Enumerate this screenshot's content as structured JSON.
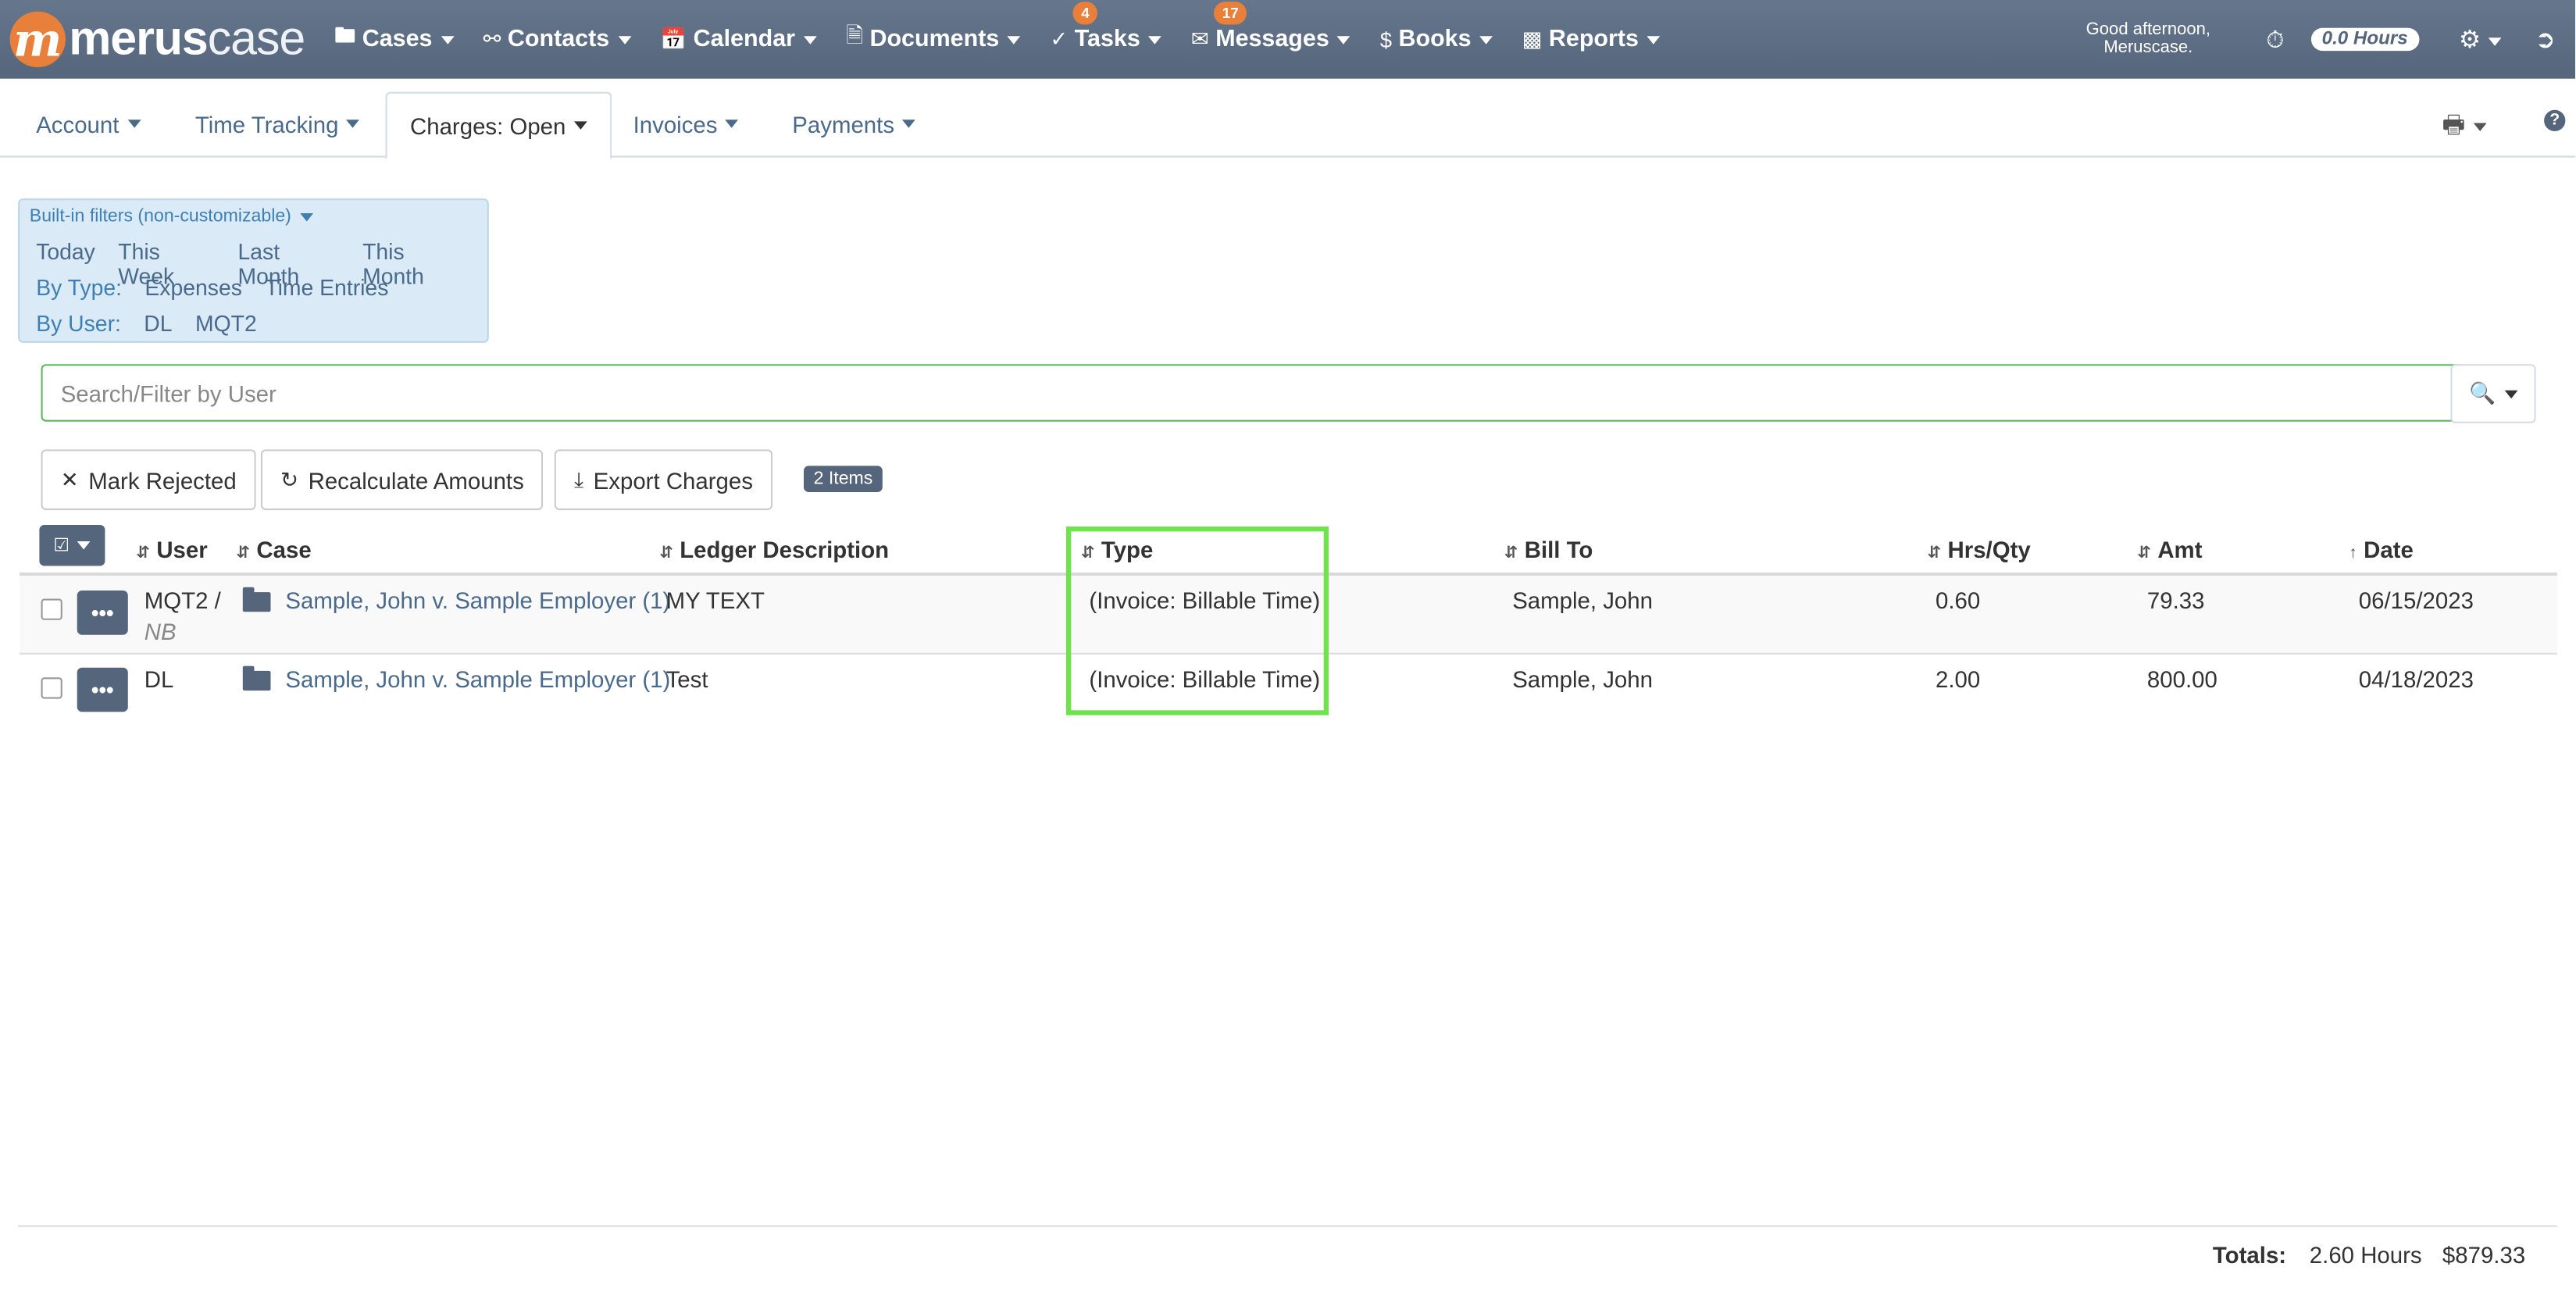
{
  "brand": {
    "logo_letter": "m",
    "name_bold": "merus",
    "name_light": "case"
  },
  "nav": {
    "items": [
      {
        "label": "Cases",
        "icon": "folder-icon"
      },
      {
        "label": "Contacts",
        "icon": "users-icon"
      },
      {
        "label": "Calendar",
        "icon": "calendar-icon"
      },
      {
        "label": "Documents",
        "icon": "document-icon"
      },
      {
        "label": "Tasks",
        "icon": "check-circle-icon",
        "badge": "4"
      },
      {
        "label": "Messages",
        "icon": "envelope-icon",
        "badge": "17"
      },
      {
        "label": "Books",
        "icon": "dollar-circle-icon"
      },
      {
        "label": "Reports",
        "icon": "bar-chart-icon"
      }
    ],
    "greeting_line1": "Good afternoon,",
    "greeting_line2": "Meruscase.",
    "hours": "0.0 Hours"
  },
  "tabs": [
    {
      "label": "Account"
    },
    {
      "label": "Time Tracking"
    },
    {
      "label": "Charges: Open",
      "active": true
    },
    {
      "label": "Invoices"
    },
    {
      "label": "Payments"
    }
  ],
  "filters": {
    "header": "Built-in filters (non-customizable)",
    "dates": [
      "Today",
      "This Week",
      "Last Month",
      "This Month"
    ],
    "by_type_label": "By Type:",
    "types": [
      "Expenses",
      "Time Entries"
    ],
    "by_user_label": "By User:",
    "users": [
      "DL",
      "MQT2"
    ]
  },
  "search": {
    "placeholder": "Search/Filter by User",
    "value": ""
  },
  "actions": {
    "mark_rejected": "Mark Rejected",
    "recalculate": "Recalculate Amounts",
    "export": "Export Charges",
    "items_count": "2 Items"
  },
  "table": {
    "columns": {
      "user": "User",
      "case": "Case",
      "ledger": "Ledger Description",
      "type": "Type",
      "bill_to": "Bill To",
      "hrs_qty": "Hrs/Qty",
      "amt": "Amt",
      "date": "Date"
    },
    "rows": [
      {
        "user": "MQT2 /",
        "user_sub": "NB",
        "case": "Sample, John v. Sample Employer (1)",
        "ledger": "MY TEXT",
        "type": "(Invoice: Billable Time)",
        "bill_to": "Sample, John",
        "hrs_qty": "0.60",
        "amt": "79.33",
        "date": "06/15/2023"
      },
      {
        "user": "DL",
        "user_sub": "",
        "case": "Sample, John v. Sample Employer (1)",
        "ledger": "Test",
        "type": "(Invoice: Billable Time)",
        "bill_to": "Sample, John",
        "hrs_qty": "2.00",
        "amt": "800.00",
        "date": "04/18/2023"
      }
    ]
  },
  "totals": {
    "label": "Totals:",
    "hours": "2.60 Hours",
    "amount": "$879.33"
  },
  "colors": {
    "nav_bg": "#5d6e84",
    "accent_orange": "#e8803b",
    "link": "#4a6a8c",
    "highlight": "#6fe34b",
    "filter_bg": "#daeaf6"
  }
}
